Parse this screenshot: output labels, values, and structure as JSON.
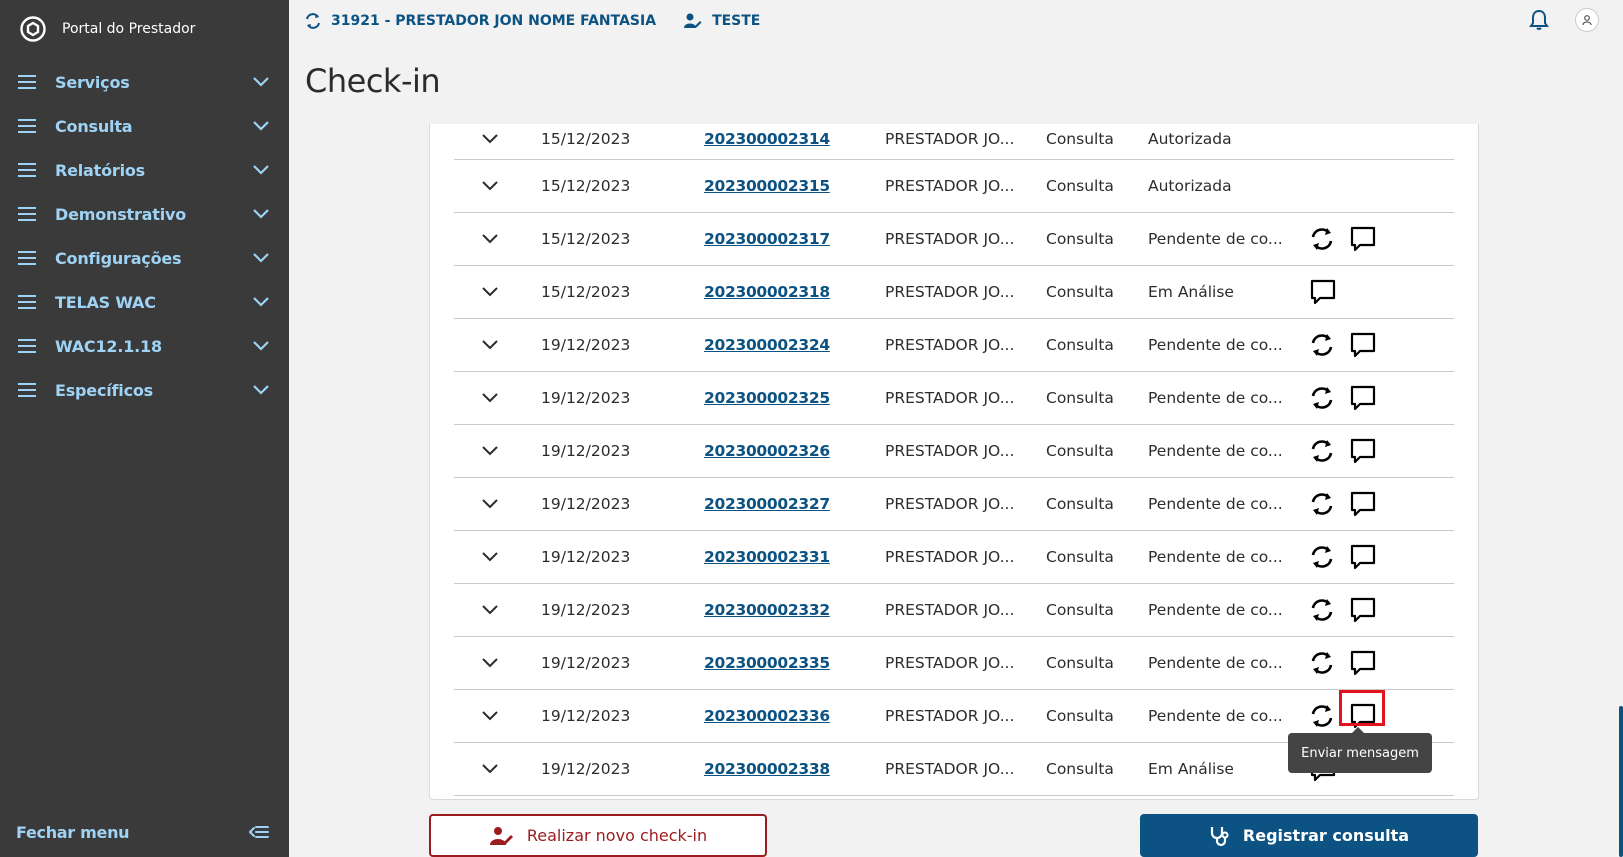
{
  "sidebar": {
    "brand": "Portal do Prestador",
    "items": [
      {
        "label": "Serviços"
      },
      {
        "label": "Consulta"
      },
      {
        "label": "Relatórios"
      },
      {
        "label": "Demonstrativo"
      },
      {
        "label": "Configurações"
      },
      {
        "label": "TELAS WAC"
      },
      {
        "label": "WAC12.1.18"
      },
      {
        "label": "Específicos"
      }
    ],
    "footer_label": "Fechar menu"
  },
  "header": {
    "provider": "31921 - PRESTADOR JON NOME FANTASIA",
    "user": "TESTE"
  },
  "page": {
    "title": "Check-in"
  },
  "table": {
    "rows": [
      {
        "date": "15/12/2023",
        "number": "202300002314",
        "provider": "PRESTADOR JO...",
        "type": "Consulta",
        "status": "Autorizada",
        "actions": "none"
      },
      {
        "date": "15/12/2023",
        "number": "202300002315",
        "provider": "PRESTADOR JO...",
        "type": "Consulta",
        "status": "Autorizada",
        "actions": "none"
      },
      {
        "date": "15/12/2023",
        "number": "202300002317",
        "provider": "PRESTADOR JO...",
        "type": "Consulta",
        "status": "Pendente de co...",
        "actions": "both"
      },
      {
        "date": "15/12/2023",
        "number": "202300002318",
        "provider": "PRESTADOR JO...",
        "type": "Consulta",
        "status": "Em Análise",
        "actions": "message"
      },
      {
        "date": "19/12/2023",
        "number": "202300002324",
        "provider": "PRESTADOR JO...",
        "type": "Consulta",
        "status": "Pendente de co...",
        "actions": "both"
      },
      {
        "date": "19/12/2023",
        "number": "202300002325",
        "provider": "PRESTADOR JO...",
        "type": "Consulta",
        "status": "Pendente de co...",
        "actions": "both"
      },
      {
        "date": "19/12/2023",
        "number": "202300002326",
        "provider": "PRESTADOR JO...",
        "type": "Consulta",
        "status": "Pendente de co...",
        "actions": "both"
      },
      {
        "date": "19/12/2023",
        "number": "202300002327",
        "provider": "PRESTADOR JO...",
        "type": "Consulta",
        "status": "Pendente de co...",
        "actions": "both"
      },
      {
        "date": "19/12/2023",
        "number": "202300002331",
        "provider": "PRESTADOR JO...",
        "type": "Consulta",
        "status": "Pendente de co...",
        "actions": "both"
      },
      {
        "date": "19/12/2023",
        "number": "202300002332",
        "provider": "PRESTADOR JO...",
        "type": "Consulta",
        "status": "Pendente de co...",
        "actions": "both"
      },
      {
        "date": "19/12/2023",
        "number": "202300002335",
        "provider": "PRESTADOR JO...",
        "type": "Consulta",
        "status": "Pendente de co...",
        "actions": "both"
      },
      {
        "date": "19/12/2023",
        "number": "202300002336",
        "provider": "PRESTADOR JO...",
        "type": "Consulta",
        "status": "Pendente de co...",
        "actions": "both"
      },
      {
        "date": "19/12/2023",
        "number": "202300002338",
        "provider": "PRESTADOR JO...",
        "type": "Consulta",
        "status": "Em Análise",
        "actions": "message"
      }
    ]
  },
  "tooltip": {
    "text": "Enviar mensagem"
  },
  "buttons": {
    "new_checkin": "Realizar novo check-in",
    "register": "Registrar consulta"
  },
  "colors": {
    "sidebar_bg": "#3a3a3a",
    "sidebar_text": "#9fd3f5",
    "primary": "#0c5282",
    "danger": "#9b1b1e",
    "highlight": "#e0141e"
  }
}
